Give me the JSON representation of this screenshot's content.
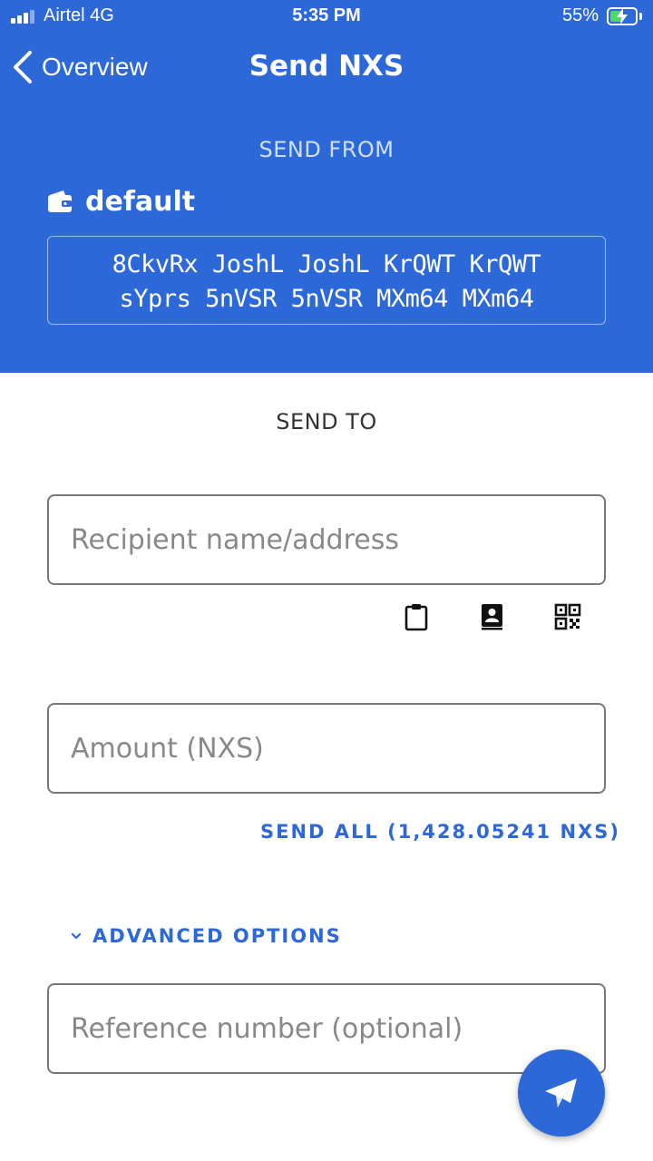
{
  "status_bar": {
    "carrier": "Airtel  4G",
    "time": "5:35 PM",
    "battery_percent": "55%",
    "battery_level": 0.55,
    "charging": true,
    "signal_bars": 3
  },
  "nav": {
    "back_label": "Overview",
    "title": "Send NXS",
    "back_icon": "chevron-left-icon"
  },
  "send_from": {
    "label": "SEND FROM",
    "account_icon": "wallet-icon",
    "account_name": "default",
    "address_line1": "8CkvRx JoshL JoshL KrQWT KrQWT",
    "address_line2": "sYprs 5nVSR 5nVSR MXm64 MXm64"
  },
  "send_to": {
    "label": "SEND TO",
    "recipient_placeholder": "Recipient name/address",
    "recipient_value": "",
    "actions": [
      {
        "icon": "clipboard-icon"
      },
      {
        "icon": "address-book-icon"
      },
      {
        "icon": "qr-code-icon"
      }
    ]
  },
  "amount": {
    "placeholder": "Amount (NXS)",
    "value": "",
    "send_all_label": "SEND ALL (1,428.05241 NXS)"
  },
  "advanced": {
    "label": "ADVANCED OPTIONS",
    "icon": "chevron-down-icon",
    "reference_placeholder": "Reference number (optional)",
    "reference_value": ""
  },
  "fab": {
    "icon": "paper-plane-icon"
  },
  "colors": {
    "primary": "#2d68d8",
    "battery_green": "#4cd964",
    "background": "#ffffff"
  }
}
